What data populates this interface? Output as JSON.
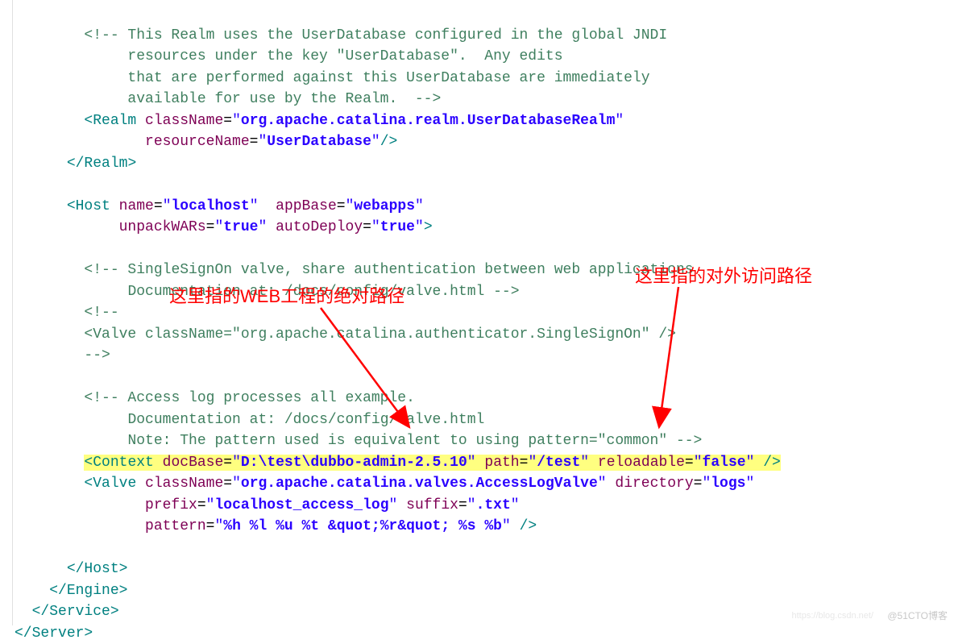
{
  "lines": {
    "l1": "        <!-- This Realm uses the UserDatabase configured in the global JNDI",
    "l2": "             resources under the key \"UserDatabase\".  Any edits",
    "l3": "             that are performed against this UserDatabase are immediately",
    "l4": "             available for use by the Realm.  -->",
    "l5_open": "        <",
    "l5_tag": "Realm",
    "l5_sp": " ",
    "l5_attr1": "className",
    "l5_eq": "=",
    "l5_q": "\"",
    "l5_val1": "org.apache.catalina.realm.UserDatabaseRealm",
    "l6_pad": "               ",
    "l6_attr": "resourceName",
    "l6_val": "UserDatabase",
    "l6_close": "/>",
    "l7_pad": "      ",
    "l7_tag": "Realm",
    "l9_pad": "      ",
    "l9_tag": "Host",
    "l9_attr1": "name",
    "l9_val1": "localhost",
    "l9_attr2": "appBase",
    "l9_val2": "webapps",
    "l10_pad": "            ",
    "l10_attr1": "unpackWARs",
    "l10_val1": "true",
    "l10_attr2": "autoDeploy",
    "l10_val2": "true",
    "l12_pad": "        ",
    "l12_text": "<!-- SingleSignOn valve, share authentication between web applications",
    "l13_pad": "             ",
    "l13_text": "Documentation at: /docs/config/valve.html -->",
    "l14_pad": "        ",
    "l14_text": "<!--",
    "l15_pad": "        ",
    "l15_text": "<Valve className=\"org.apache.catalina.authenticator.SingleSignOn\" />",
    "l16_pad": "        ",
    "l16_text": "-->",
    "l18_pad": "        ",
    "l18_text": "<!-- Access log processes all example.",
    "l19_pad": "             ",
    "l19_text": "Documentation at: /docs/config/valve.html",
    "l20_pad": "             ",
    "l20_text": "Note: The pattern used is equivalent to using pattern=\"common\" -->",
    "l21_pad": "        ",
    "l21_tag": "Context",
    "l21_attr1": "docBase",
    "l21_val1": "D:\\test\\dubbo-admin-2.5.10",
    "l21_attr2": "path",
    "l21_val2": "/test",
    "l21_attr3": "reloadable",
    "l21_val3": "false",
    "l22_pad": "        ",
    "l22_tag": "Valve",
    "l22_attr1": "className",
    "l22_val1": "org.apache.catalina.valves.AccessLogValve",
    "l22_attr2": "directory",
    "l22_val2": "logs",
    "l23_pad": "               ",
    "l23_attr1": "prefix",
    "l23_val1": "localhost_access_log",
    "l23_attr2": "suffix",
    "l23_val2": ".txt",
    "l24_pad": "               ",
    "l24_attr": "pattern",
    "l24_val": "%h %l %u %t &quot;%r&quot; %s %b",
    "l26_pad": "      ",
    "l26_tag": "Host",
    "l27_pad": "    ",
    "l27_tag": "Engine",
    "l28_pad": "  ",
    "l28_tag": "Service",
    "l29_tag": "Server"
  },
  "annotation": {
    "left": "这里指的WEB工程的绝对路径",
    "right": "这里指的对外访问路径"
  },
  "watermark": "@51CTO博客",
  "watermark2": "https://blog.csdn.net/"
}
